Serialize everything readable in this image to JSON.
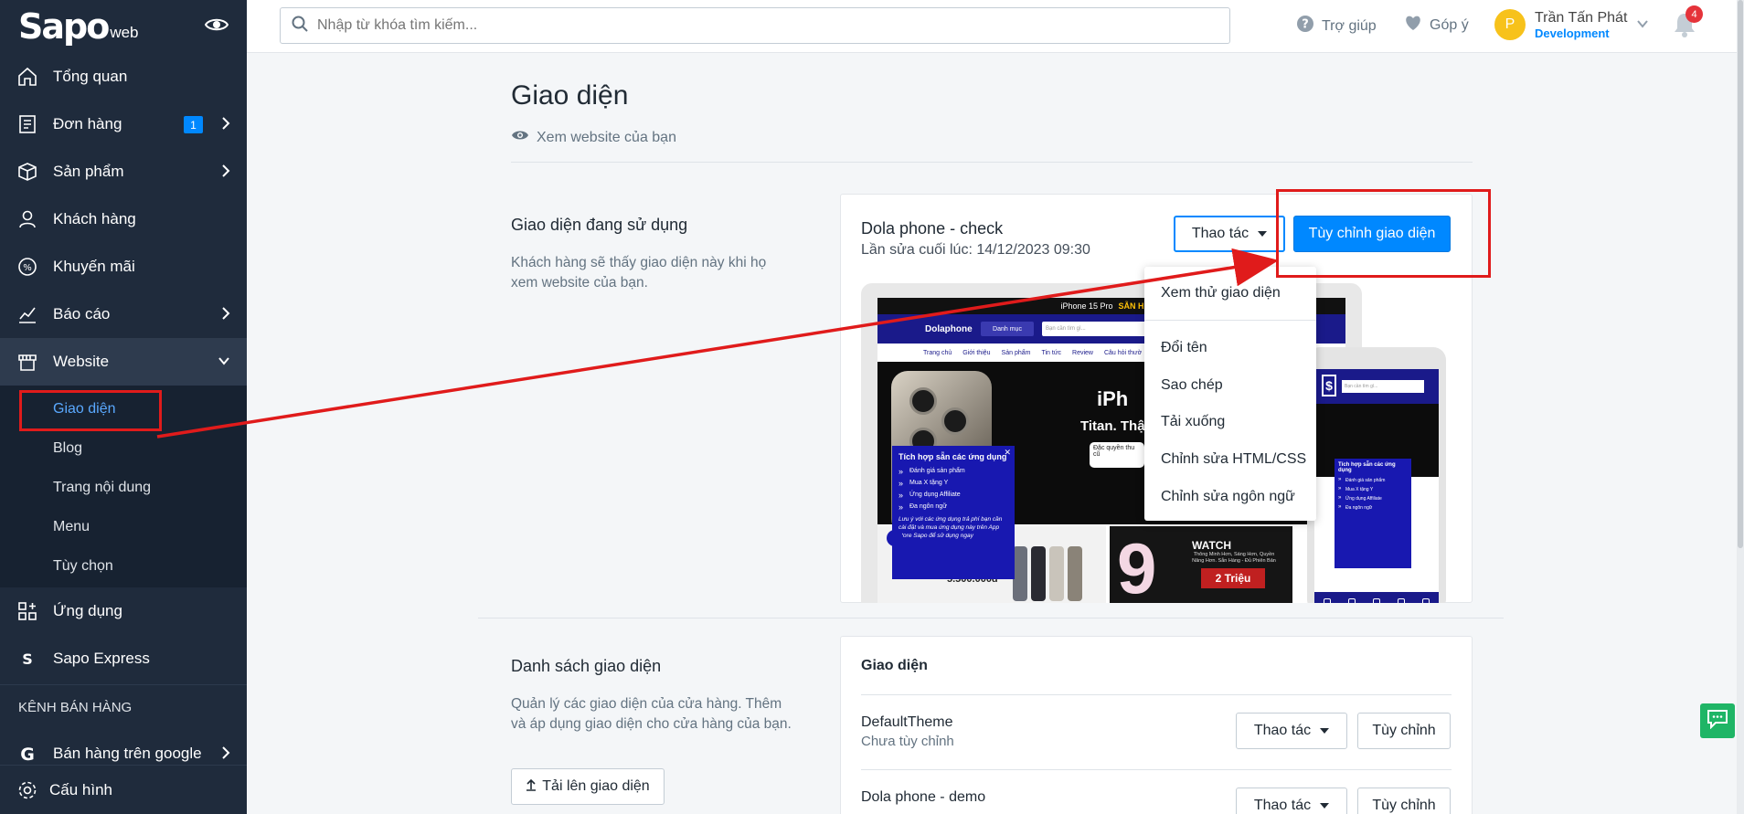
{
  "sidebar": {
    "logo_main": "Sapo",
    "logo_sub": "web",
    "items": [
      {
        "label": "Tổng quan"
      },
      {
        "label": "Đơn hàng",
        "badge": "1"
      },
      {
        "label": "Sản phẩm"
      },
      {
        "label": "Khách hàng"
      },
      {
        "label": "Khuyến mãi"
      },
      {
        "label": "Báo cáo"
      },
      {
        "label": "Website"
      }
    ],
    "website_sub": [
      "Giao diện",
      "Blog",
      "Trang nội dung",
      "Menu",
      "Tùy chọn"
    ],
    "items2": [
      {
        "label": "Ứng dụng"
      },
      {
        "label": "Sapo Express"
      }
    ],
    "section_label": "KÊNH BÁN HÀNG",
    "channel_item": "Bán hàng trên google",
    "bottom_item": "Cấu hình"
  },
  "topbar": {
    "search_placeholder": "Nhập từ khóa tìm kiếm...",
    "help": "Trợ giúp",
    "feedback": "Góp ý",
    "avatar_letter": "P",
    "user_name": "Trần Tấn Phát",
    "user_role": "Development",
    "notif_count": "4"
  },
  "main": {
    "title": "Giao diện",
    "view_site": "Xem website của bạn",
    "current": {
      "section_title": "Giao diện đang sử dụng",
      "section_desc": "Khách hàng sẽ thấy giao diện này khi họ xem website của bạn.",
      "theme_name": "Dola phone - check",
      "last_edit": "Lần sửa cuối lúc: 14/12/2023 09:30",
      "actions_label": "Thao tác",
      "customize_label": "Tùy chỉnh giao diện"
    },
    "dropdown": [
      "Xem thử giao diện",
      "Đổi tên",
      "Sao chép",
      "Tải xuống",
      "Chỉnh sửa HTML/CSS",
      "Chỉnh sửa ngôn ngữ"
    ],
    "list": {
      "section_title": "Danh sách giao diện",
      "section_desc": "Quản lý các giao diện của cửa hàng. Thêm và áp dụng giao diện cho cửa hàng của bạn.",
      "upload_label": "Tải lên giao diện",
      "card_title": "Giao diện",
      "rows": [
        {
          "name": "DefaultTheme",
          "status": "Chưa tùy chỉnh",
          "actions": "Thao tác",
          "customize": "Tùy chỉnh"
        },
        {
          "name": "Dola phone - demo",
          "status": "",
          "actions": "Thao tác",
          "customize": "Tùy chỉnh"
        }
      ]
    }
  },
  "preview": {
    "promo_text": "iPhone 15 Pro",
    "promo_highlight": "SẴN HÀNG",
    "logo": "Dolaphone",
    "menu_btn": "Danh mục",
    "search_placeholder": "Bạn cần tìm gì...",
    "nav": [
      "Trang chủ",
      "Giới thiệu",
      "Sản phẩm",
      "Tin tức",
      "Review",
      "Câu hỏi thườ"
    ],
    "hero_line1": "iPh",
    "hero_line2": "Titan. Thật bền",
    "hero_chip": "Đặc quyền thu cũ",
    "popup_title": "Tích hợp sẵn các ứng dụng",
    "popup_items": [
      "Đánh giá sản phẩm",
      "Mua X tặng Y",
      "Ứng dụng Affiliate",
      "Đa ngôn ngữ"
    ],
    "popup_note": "Lưu ý với các ứng dụng trả phí bạn cần cài đặt và mua ứng dụng này trên App store Sapo để sử dụng ngay",
    "tile_price": "5.500.000đ",
    "watch_title": "WATCH",
    "watch_sub": "Thông Minh Hơn, Sáng Hơn, Quyền Năng Hơn. Sẵn Hàng - Đủ Phiên Bản",
    "watch_price": "2 Triệu",
    "mobile_search": "Bạn cần tìm gì...",
    "mobile_popup_title": "Tích hợp sẵn các ứng dụng"
  },
  "colors": {
    "sidebar_bg": "#1f2b3c",
    "primary": "#0088ff",
    "annotation": "#e01b1b"
  }
}
